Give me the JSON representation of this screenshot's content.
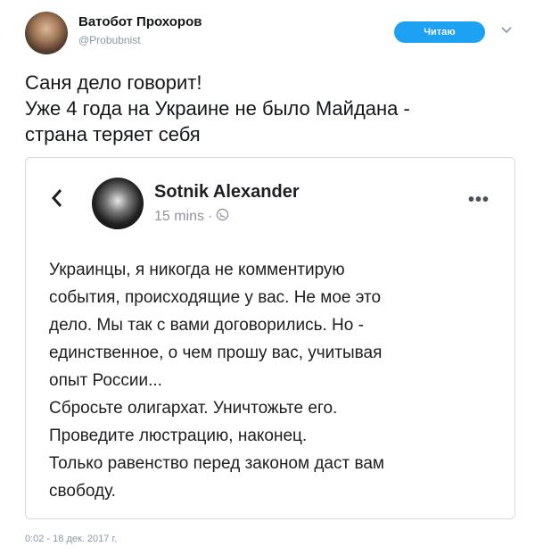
{
  "tweet": {
    "author_name": "Ватобот Прохоров",
    "author_handle": "@Probubnist",
    "follow_label": "Читаю",
    "text_lines": [
      "Саня дело говорит!",
      "Уже 4 года на Украине не было Майдана -",
      "страна теряет себя"
    ],
    "timestamp": "0:02 - 18 дек. 2017 г.",
    "icons": {
      "caret": "chevron-down-icon"
    }
  },
  "embed": {
    "name": "Sotnik Alexander",
    "time": "15 mins",
    "separator": "·",
    "body_lines": [
      "Украинцы, я никогда не комментирую",
      "события, происходящие у вас. Не мое это",
      "дело. Мы так с вами договорились. Но -",
      "единственное, о чем прошу вас, учитывая",
      "опыт России...",
      "Сбросьте олигархат. Уничтожьте его.",
      "Проведите люстрацию, наконец.",
      "Только равенство перед законом даст вам",
      "свободу."
    ],
    "icons": {
      "back": "chevron-left-icon",
      "privacy": "globe-icon",
      "more": "more-dots-icon"
    }
  },
  "colors": {
    "accent": "#1da1f2",
    "muted": "#8899a6",
    "card_border": "#d6dbe0"
  }
}
